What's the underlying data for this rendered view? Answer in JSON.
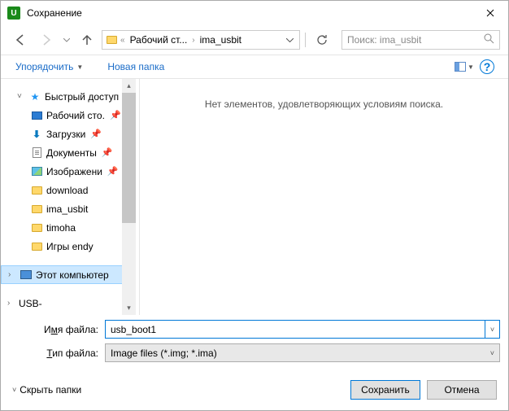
{
  "window": {
    "title": "Сохранение"
  },
  "nav": {
    "breadcrumbs": [
      "Рабочий ст...",
      "ima_usbit"
    ],
    "search_placeholder": "Поиск: ima_usbit"
  },
  "toolbar": {
    "organize": "Упорядочить",
    "new_folder": "Новая папка"
  },
  "tree": {
    "quick_access": "Быстрый доступ",
    "this_pc": "Этот компьютер",
    "usb_cut": "USB-",
    "items": [
      {
        "label": "Рабочий сто.",
        "icon": "desktop",
        "pinned": true
      },
      {
        "label": "Загрузки",
        "icon": "download",
        "pinned": true
      },
      {
        "label": "Документы",
        "icon": "doc",
        "pinned": true
      },
      {
        "label": "Изображени",
        "icon": "img",
        "pinned": true
      },
      {
        "label": "download",
        "icon": "folder",
        "pinned": false
      },
      {
        "label": "ima_usbit",
        "icon": "folder",
        "pinned": false
      },
      {
        "label": "timoha",
        "icon": "folder",
        "pinned": false
      },
      {
        "label": "Игры endy",
        "icon": "folder",
        "pinned": false
      }
    ]
  },
  "files": {
    "empty": "Нет элементов, удовлетворяющих условиям поиска."
  },
  "fields": {
    "filename_label_pre": "И",
    "filename_label_ul": "м",
    "filename_label_post": "я файла:",
    "filetype_label_pre": "",
    "filetype_label_ul": "Т",
    "filetype_label_post": "ип файла:",
    "filename_value": "usb_boot1",
    "filetype_value": "Image files (*.img; *.ima)"
  },
  "footer": {
    "hide_folders": "Скрыть папки",
    "save": "Сохранить",
    "cancel": "Отмена"
  }
}
